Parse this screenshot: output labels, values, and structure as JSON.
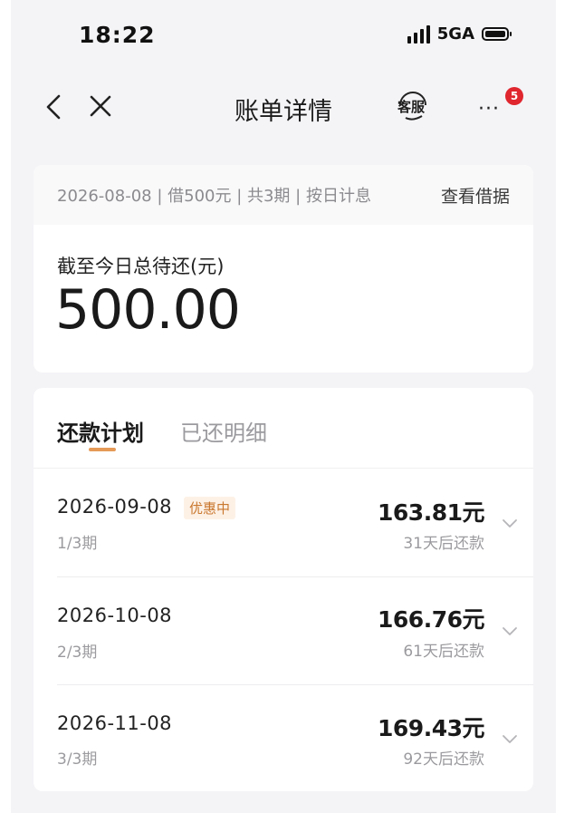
{
  "status_bar": {
    "time": "18:22",
    "network": "5GA"
  },
  "nav": {
    "title": "账单详情",
    "service_label": "客服",
    "more_badge": "5"
  },
  "summary": {
    "loan_info": "2026-08-08 | 借500元 | 共3期 | 按日计息",
    "view_link": "查看借据",
    "due_label": "截至今日总待还(元)",
    "due_amount": "500.00"
  },
  "tabs": [
    {
      "label": "还款计划",
      "active": true
    },
    {
      "label": "已还明细",
      "active": false
    }
  ],
  "installments": [
    {
      "date": "2026-09-08",
      "promo": "优惠中",
      "term": "1/3期",
      "amount": "163.81元",
      "note": "31天后还款"
    },
    {
      "date": "2026-10-08",
      "promo": "",
      "term": "2/3期",
      "amount": "166.76元",
      "note": "61天后还款"
    },
    {
      "date": "2026-11-08",
      "promo": "",
      "term": "3/3期",
      "amount": "169.43元",
      "note": "92天后还款"
    }
  ],
  "colors": {
    "accent": "#e69a57",
    "badge": "#e0262e",
    "promo_text": "#c9782f",
    "page_bg": "#f4f4f7"
  }
}
